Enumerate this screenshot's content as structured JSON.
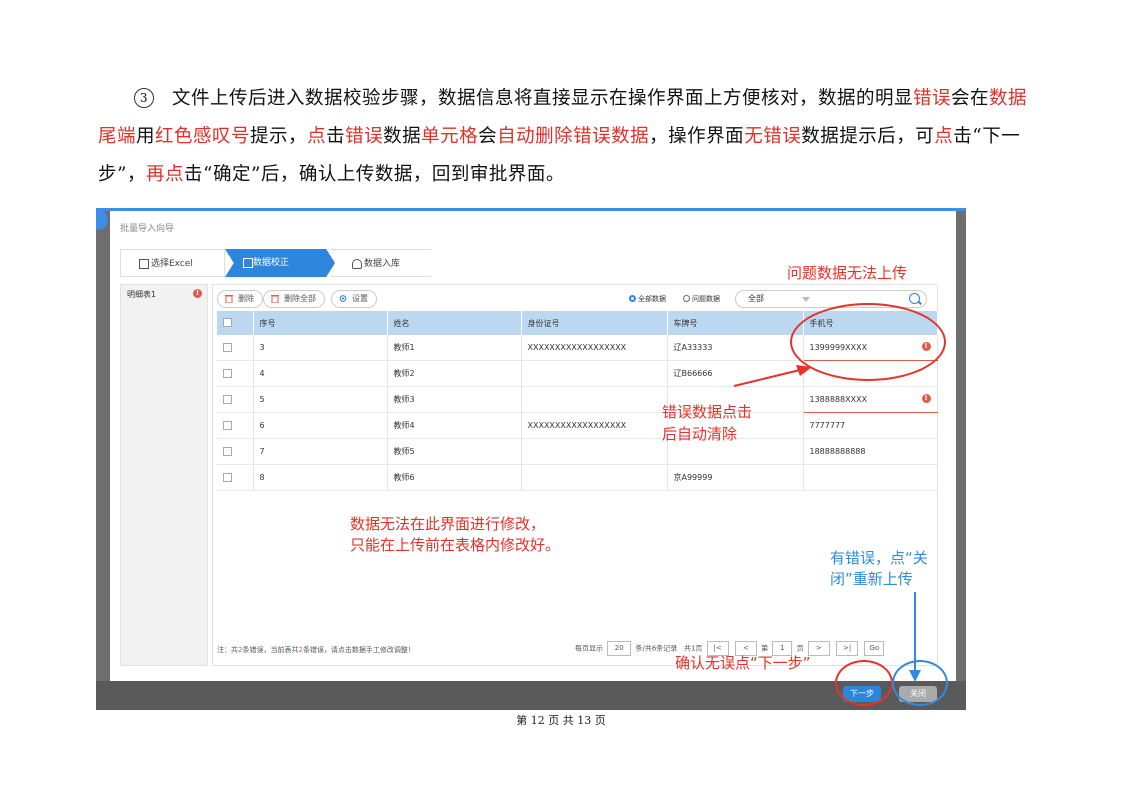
{
  "paragraph": {
    "marker": "3",
    "s1": "文件上传后进入数据校验步骤，数据信息将直接显示在操作界面上方便核对，数据的明显",
    "r1": "错误",
    "s2": "会在",
    "r2": "数据尾端",
    "s3": "用",
    "r3": "红色感叹号",
    "s4": "提示，",
    "r4": "点",
    "s5": "击",
    "r5": "错误",
    "s6": "数据",
    "r6": "单元格",
    "s7": "会",
    "r7": "自动删除错误数据",
    "s8": "，操作界面",
    "r8": "无错误",
    "s9": "数据提示后，可",
    "r9": "点",
    "s10": "击“下一步”，",
    "r10": "再点",
    "s11": "击“确定”后，确认上传数据，回到审批界面。"
  },
  "dialog": {
    "title": "批量导入向导",
    "steps": [
      "选择Excel",
      "数据校正",
      "数据入库"
    ],
    "sidebar_item": "明细表1",
    "toolbar": {
      "delete": "删除",
      "delete_all": "删除全部",
      "settings": "设置"
    },
    "radios": {
      "all": "全部数据",
      "problem": "问题数据"
    },
    "select_value": "全部",
    "columns": [
      "序号",
      "姓名",
      "身份证号",
      "车牌号",
      "手机号"
    ],
    "rows": [
      {
        "no": "3",
        "name": "教师1",
        "id": "XXXXXXXXXXXXXXXXXX",
        "plate": "辽A33333",
        "phone": "1399999XXXX"
      },
      {
        "no": "4",
        "name": "教师2",
        "id": "",
        "plate": "辽B66666",
        "phone": ""
      },
      {
        "no": "5",
        "name": "教师3",
        "id": "",
        "plate": "",
        "phone": "1388888XXXX"
      },
      {
        "no": "6",
        "name": "教师4",
        "id": "XXXXXXXXXXXXXXXXXX",
        "plate": "",
        "phone": "7777777"
      },
      {
        "no": "7",
        "name": "教师5",
        "id": "",
        "plate": "",
        "phone": "18888888888"
      },
      {
        "no": "8",
        "name": "教师6",
        "id": "",
        "plate": "京A99999",
        "phone": ""
      }
    ],
    "footer_note": {
      "prefix": "注：共",
      "n1": "2",
      "mid": "条错误，当前表共",
      "n2": "2",
      "suffix": "条错误，请点击数据手工修改调整！"
    },
    "pager": {
      "per_page_label": "每页显示",
      "per_page": "20",
      "total": "条/共6条记录",
      "pages": "共1页",
      "page_prefix": "第",
      "page": "1",
      "page_suffix": "页",
      "go": "Go"
    },
    "btn_next": "下一步",
    "btn_close": "关闭"
  },
  "annotations": {
    "problem_data": "问题数据无法上传",
    "click_clear_1": "错误数据点击",
    "click_clear_2": "后自动清除",
    "cannot_edit_1": "数据无法在此界面进行修改，",
    "cannot_edit_2": "只能在上传前在表格内修改好。",
    "close_hint_1": "有错误，点“关",
    "close_hint_2": "闭”重新上传",
    "confirm_next": "确认无误点“下一步”"
  },
  "page_number": "第 12 页 共 13 页",
  "colors": {
    "red": "#e6322a",
    "blue": "#2f8be0",
    "header_blue": "#bcd7f0",
    "step_active": "#2e85dd"
  }
}
